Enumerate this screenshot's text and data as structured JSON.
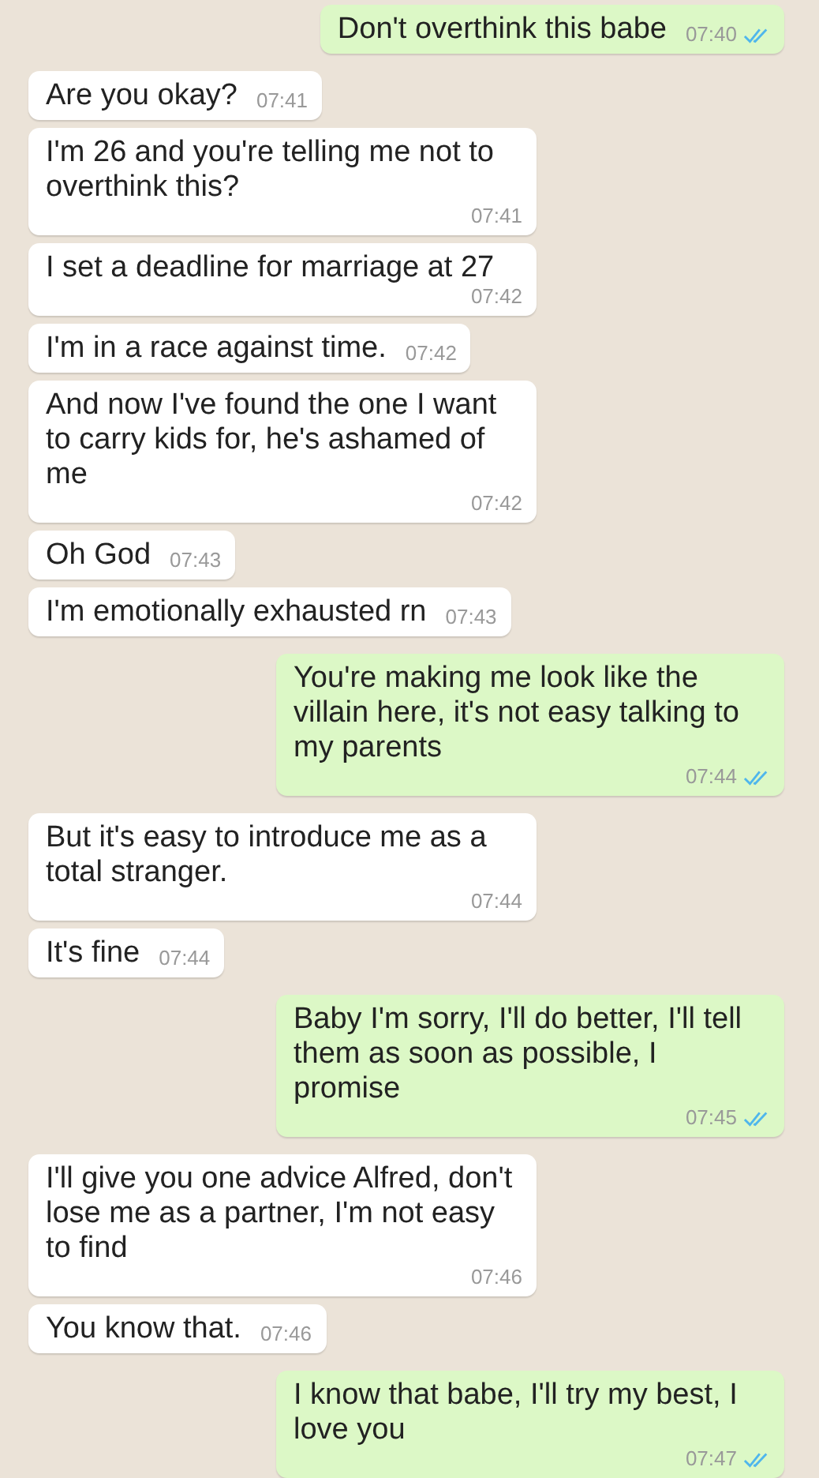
{
  "messages": [
    {
      "kind": "out",
      "text": "Don't overthink this babe",
      "time": "07:40",
      "read": true
    },
    {
      "kind": "in",
      "text": "Are you okay?",
      "time": "07:41"
    },
    {
      "kind": "in",
      "text": "I'm 26 and you're telling me not to overthink this?",
      "time": "07:41"
    },
    {
      "kind": "in",
      "text": "I set a deadline for marriage at 27",
      "time": "07:42"
    },
    {
      "kind": "in",
      "text": "I'm in a race against time.",
      "time": "07:42"
    },
    {
      "kind": "in",
      "text": "And now I've found the one I want to carry kids for, he's ashamed of me",
      "time": "07:42"
    },
    {
      "kind": "in",
      "text": "Oh God",
      "time": "07:43"
    },
    {
      "kind": "in",
      "text": "I'm emotionally exhausted rn",
      "time": "07:43"
    },
    {
      "kind": "out",
      "text": "You're making me look like the villain here, it's not easy talking to my parents",
      "time": "07:44",
      "read": true
    },
    {
      "kind": "in",
      "text": "But it's easy to introduce me as a total stranger.",
      "time": "07:44"
    },
    {
      "kind": "in",
      "text": "It's fine",
      "time": "07:44"
    },
    {
      "kind": "out",
      "text": "Baby I'm sorry, I'll do better, I'll tell them as soon as possible, I promise",
      "time": "07:45",
      "read": true
    },
    {
      "kind": "in",
      "text": "I'll give you one advice Alfred, don't lose me as a partner, I'm not easy to find",
      "time": "07:46"
    },
    {
      "kind": "in",
      "text": "You know that.",
      "time": "07:46"
    },
    {
      "kind": "out",
      "text": "I know that babe, I'll try my best, I love you",
      "time": "07:47",
      "read": true
    }
  ]
}
